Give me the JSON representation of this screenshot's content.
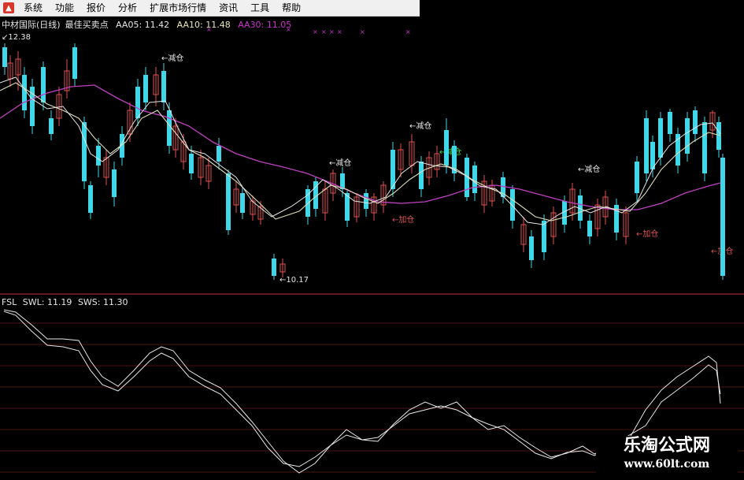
{
  "menubar": {
    "items": [
      "系统",
      "功能",
      "报价",
      "分析",
      "扩展市场行情",
      "资讯",
      "工具",
      "帮助"
    ]
  },
  "top_panel": {
    "stock_name": "中材国际(日线)",
    "indicator_name": "最佳买卖点",
    "ma_labels": [
      {
        "label": "AA05: 11.42",
        "color": "#e6e6e6"
      },
      {
        "label": "AA10: 11.48",
        "color": "#e6e6b4"
      },
      {
        "label": "AA30: 11.05",
        "color": "#cc33cc"
      }
    ],
    "high_price": "12.38",
    "low_price": "10.17",
    "annotations": [
      "减仓",
      "减仓",
      "减仓",
      "减仓",
      "减仓",
      "加仓",
      "加仓",
      "加仓"
    ]
  },
  "bottom_panel": {
    "indicator": "FSL",
    "values": [
      "SWL: 11.19",
      "SWS: 11.30"
    ]
  },
  "watermark": {
    "main": "乐淘公式网",
    "url": "www.60lt.com"
  },
  "colors": {
    "up": "#e05050",
    "down": "#40d8e8",
    "ma30": "#c040c0",
    "ma": "#dcdcb4",
    "grid": "#5a1a1a"
  }
}
